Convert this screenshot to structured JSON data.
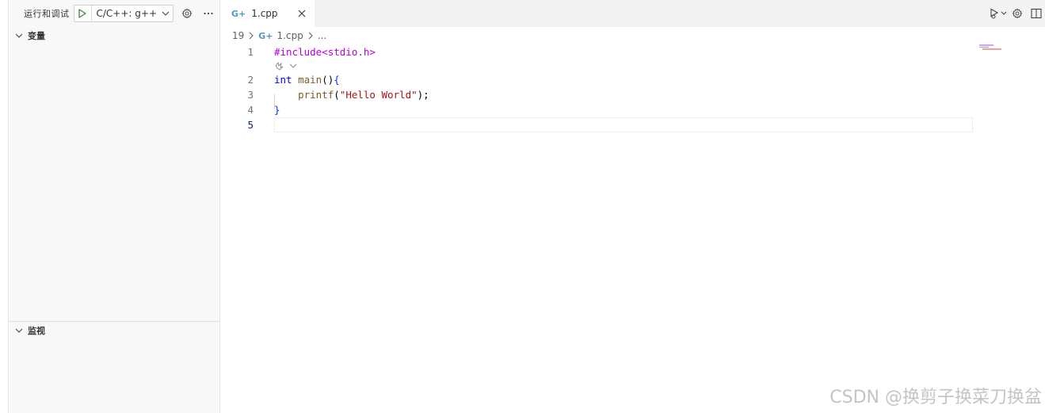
{
  "sidebar": {
    "title": "运行和调试",
    "launch_config": "C/C++: g++",
    "sections": {
      "variables": "变量",
      "watch": "监视"
    }
  },
  "tab": {
    "icon_text": "G+",
    "label": "1.cpp"
  },
  "breadcrumb": {
    "prefix": "19",
    "icon_text": "G+",
    "file": "1.cpp",
    "more": "..."
  },
  "code": {
    "lines": [
      {
        "number": "1",
        "text": "#include<stdio.h>"
      },
      {
        "number": "2",
        "text": "int main(){"
      },
      {
        "number": "3",
        "text": "    printf(\"Hello World\");"
      },
      {
        "number": "4",
        "text": "}"
      },
      {
        "number": "5",
        "text": ""
      }
    ],
    "active_line": "5"
  },
  "watermark": "CSDN @换剪子换菜刀换盆",
  "colors": {
    "accent_play": "#388a34",
    "cpp_icon": "#519aba",
    "preprocessor": "#af00db",
    "keyword": "#0000ff",
    "function": "#795e26",
    "string": "#a31515"
  }
}
